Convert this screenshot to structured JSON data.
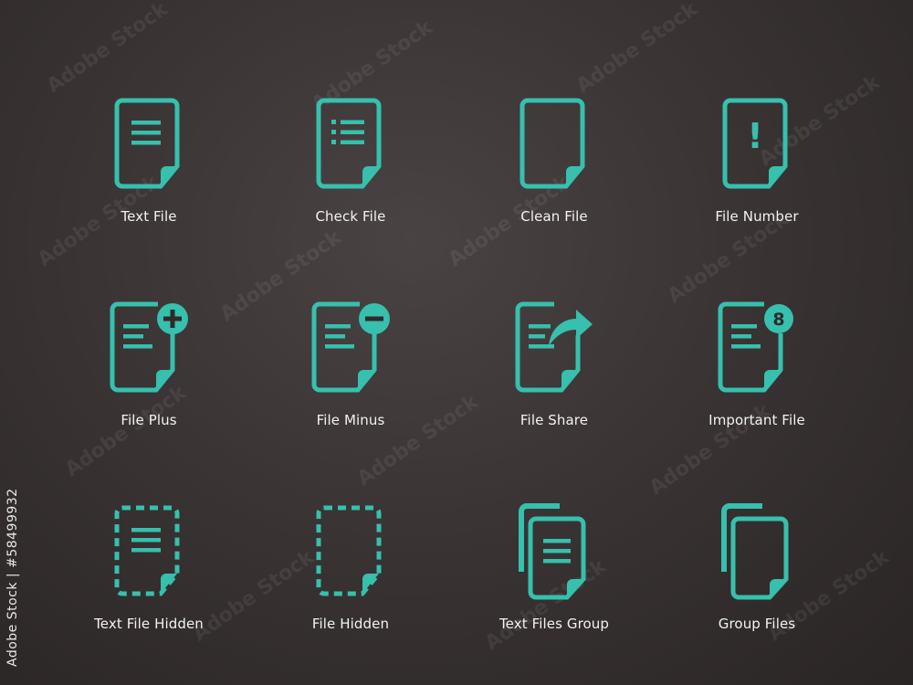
{
  "accent_color": "#36c0ad",
  "background_color": "#3a3434",
  "watermark_text": "Adobe Stock",
  "image_id_text": "Adobe Stock | #58499932",
  "icons": [
    {
      "label": "Text File",
      "icon": "text-file-icon"
    },
    {
      "label": "Check File",
      "icon": "check-file-icon"
    },
    {
      "label": "Clean File",
      "icon": "clean-file-icon"
    },
    {
      "label": "File Number",
      "icon": "file-number-icon"
    },
    {
      "label": "File Plus",
      "icon": "file-plus-icon"
    },
    {
      "label": "File Minus",
      "icon": "file-minus-icon"
    },
    {
      "label": "File Share",
      "icon": "file-share-icon"
    },
    {
      "label": "Important File",
      "icon": "important-file-icon"
    },
    {
      "label": "Text File Hidden",
      "icon": "text-file-hidden-icon"
    },
    {
      "label": "File Hidden",
      "icon": "file-hidden-icon"
    },
    {
      "label": "Text Files Group",
      "icon": "text-files-group-icon"
    },
    {
      "label": "Group Files",
      "icon": "group-files-icon"
    }
  ],
  "badges": {
    "important_file": "8",
    "file_number": "!"
  }
}
